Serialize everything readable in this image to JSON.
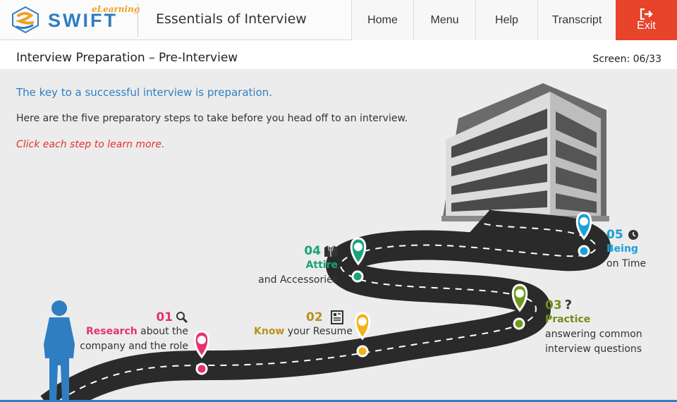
{
  "header": {
    "logo_text": "SWIFT",
    "logo_elearning": "eLearning",
    "course_title": "Essentials of Interview",
    "nav": {
      "home": "Home",
      "menu": "Menu",
      "help": "Help",
      "transcript": "Transcript",
      "exit": "Exit"
    }
  },
  "subheader": {
    "title": "Interview Preparation – Pre-Interview",
    "screen": "Screen: 06/33"
  },
  "content": {
    "intro": "The key to a successful interview is preparation.",
    "description": "Here are the five preparatory steps to take before you head off to an interview.",
    "instruction": "Click each step to learn more."
  },
  "steps": [
    {
      "num": "01",
      "keyword": "Research",
      "text1": " about the",
      "text2": "company and the role",
      "color": "#e5336d",
      "icon": "search-icon"
    },
    {
      "num": "02",
      "keyword": "Know",
      "text1": " your Resume",
      "text2": "",
      "color": "#b8901a",
      "icon": "document-icon"
    },
    {
      "num": "03",
      "keyword": "Practice",
      "text1": "",
      "text2": "answering common",
      "text3": "interview questions",
      "color": "#6f8e1a",
      "icon": "question-icon"
    },
    {
      "num": "04",
      "keyword": "Attire",
      "text1": "",
      "text2": "and Accessories",
      "color": "#1aa37a",
      "icon": "jacket-icon"
    },
    {
      "num": "05",
      "keyword": "Being",
      "text1": "",
      "text2": "on Time",
      "color": "#1aa0d8",
      "icon": "clock-icon"
    }
  ],
  "colors": {
    "accent_blue": "#2f7ec2",
    "exit_red": "#e8432b",
    "instruction_red": "#e3332a",
    "road": "#2a2a2a",
    "person": "#2f7ec2"
  }
}
